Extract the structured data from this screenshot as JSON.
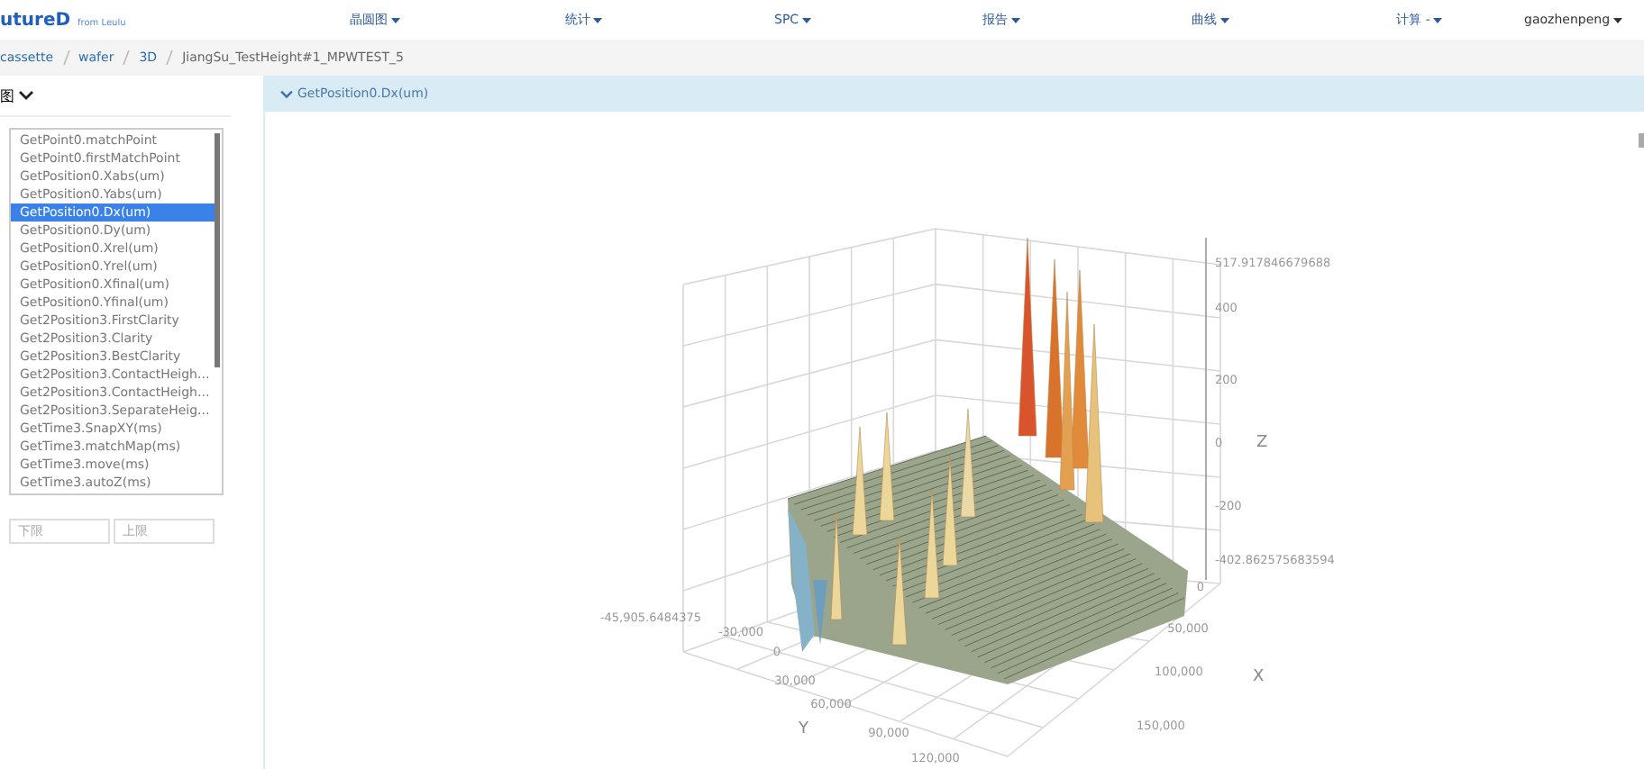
{
  "navbar": {
    "logo": "utureD",
    "logo_sub": "from Leulu",
    "menus": [
      {
        "label": "晶圆图"
      },
      {
        "label": "统计"
      },
      {
        "label": "SPC"
      },
      {
        "label": "报告"
      },
      {
        "label": "曲线"
      },
      {
        "label": "计算 -"
      }
    ],
    "user": "gaozhenpeng"
  },
  "breadcrumb": [
    "cassette",
    "wafer",
    "3D",
    "JiangSu_TestHeight#1_MPWTEST_5"
  ],
  "sidebar": {
    "title": "图",
    "items": [
      {
        "label": "GetPoint0.matchPoint",
        "selected": false
      },
      {
        "label": "GetPoint0.firstMatchPoint",
        "selected": false
      },
      {
        "label": "GetPosition0.Xabs(um)",
        "selected": false
      },
      {
        "label": "GetPosition0.Yabs(um)",
        "selected": false
      },
      {
        "label": "GetPosition0.Dx(um)",
        "selected": true
      },
      {
        "label": "GetPosition0.Dy(um)",
        "selected": false
      },
      {
        "label": "GetPosition0.Xrel(um)",
        "selected": false
      },
      {
        "label": "GetPosition0.Yrel(um)",
        "selected": false
      },
      {
        "label": "GetPosition0.Xfinal(um)",
        "selected": false
      },
      {
        "label": "GetPosition0.Yfinal(um)",
        "selected": false
      },
      {
        "label": "Get2Position3.FirstClarity",
        "selected": false
      },
      {
        "label": "Get2Position3.Clarity",
        "selected": false
      },
      {
        "label": "Get2Position3.BestClarity",
        "selected": false
      },
      {
        "label": "Get2Position3.ContactHeigh...",
        "selected": false
      },
      {
        "label": "Get2Position3.ContactHeigh...",
        "selected": false
      },
      {
        "label": "Get2Position3.SeparateHeig...",
        "selected": false
      },
      {
        "label": "GetTime3.SnapXY(ms)",
        "selected": false
      },
      {
        "label": "GetTime3.matchMap(ms)",
        "selected": false
      },
      {
        "label": "GetTime3.move(ms)",
        "selected": false
      },
      {
        "label": "GetTime3.autoZ(ms)",
        "selected": false
      }
    ],
    "lower_placeholder": "下限",
    "upper_placeholder": "上限"
  },
  "panel": {
    "title": "GetPosition0.Dx(um)",
    "plot": {
      "z_label": "Z",
      "z_ticks": [
        "517.917846679688",
        "400",
        "200",
        "0",
        "-200",
        "-402.862575683594"
      ],
      "x_label": "X",
      "x_ticks": [
        "0",
        "50,000",
        "100,000",
        "150,000"
      ],
      "y_label": "Y",
      "y_ticks": [
        "-45,905.6484375",
        "-30,000",
        "0",
        "30,000",
        "60,000",
        "90,000",
        "120,000"
      ]
    }
  }
}
